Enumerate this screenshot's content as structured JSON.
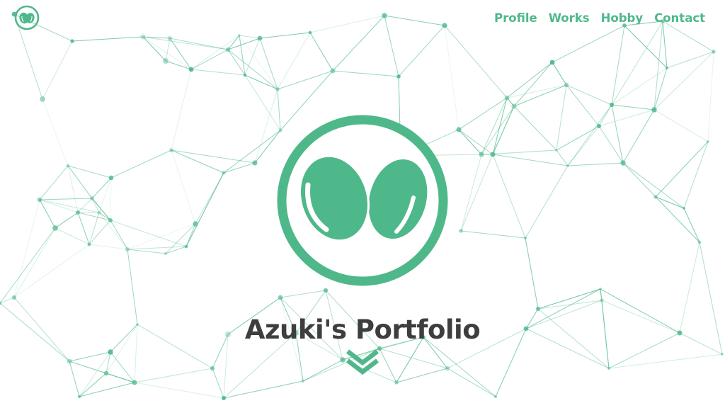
{
  "site": {
    "title": "Azuki's Portfolio"
  },
  "nav": {
    "items": [
      {
        "label": "Profile"
      },
      {
        "label": "Works"
      },
      {
        "label": "Hobby"
      },
      {
        "label": "Contact"
      }
    ]
  },
  "icons": {
    "nav_logo": "azuki-bean-logo-icon",
    "hero_logo": "azuki-bean-logo-icon",
    "scroll": "double-chevron-down-icon"
  },
  "colors": {
    "accent": "#4fb88a",
    "title": "#3e3e3e",
    "background": "#ffffff"
  }
}
